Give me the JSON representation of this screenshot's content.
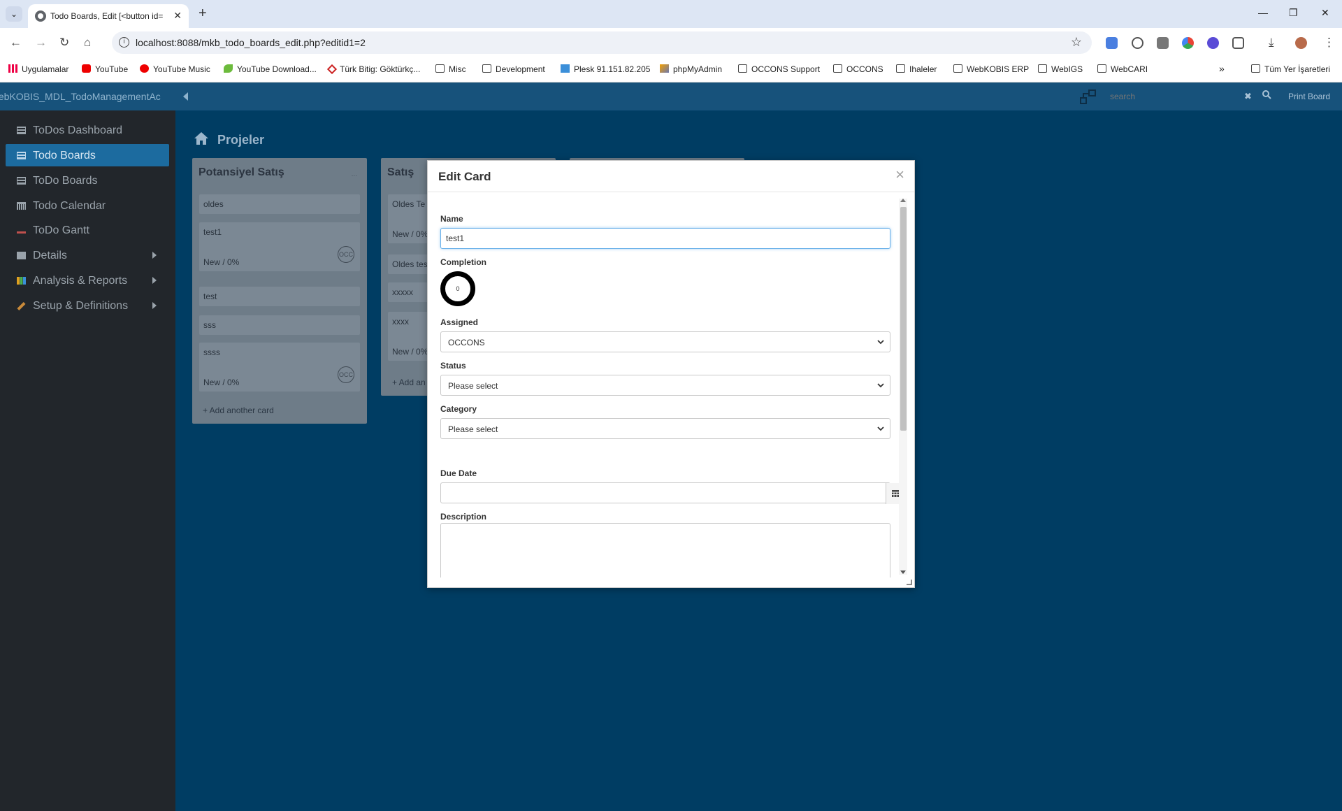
{
  "browser": {
    "tab_title": "Todo Boards, Edit [<button id=",
    "url": "localhost:8088/mkb_todo_boards_edit.php?editid1=2",
    "bookmarks": [
      {
        "label": "Uygulamalar",
        "icon": "apps-grid-icon"
      },
      {
        "label": "YouTube",
        "icon": "youtube-icon"
      },
      {
        "label": "YouTube Music",
        "icon": "youtube-music-icon"
      },
      {
        "label": "YouTube Download...",
        "icon": "leaf-icon"
      },
      {
        "label": "Türk Bitig: Göktürkç...",
        "icon": "gem-icon"
      },
      {
        "label": "Misc",
        "icon": "folder-icon"
      },
      {
        "label": "Development",
        "icon": "folder-icon"
      },
      {
        "label": "Plesk 91.151.82.205",
        "icon": "plesk-icon"
      },
      {
        "label": "phpMyAdmin",
        "icon": "phpmyadmin-icon"
      },
      {
        "label": "OCCONS Support",
        "icon": "folder-icon"
      },
      {
        "label": "OCCONS",
        "icon": "folder-icon"
      },
      {
        "label": "Ihaleler",
        "icon": "folder-icon"
      },
      {
        "label": "WebKOBIS ERP",
        "icon": "folder-icon"
      },
      {
        "label": "WebIGS",
        "icon": "folder-icon"
      },
      {
        "label": "WebCARI",
        "icon": "folder-icon"
      }
    ],
    "bookmarks_overflow": "»",
    "all_bookmarks": "Tüm Yer İşaretleri"
  },
  "app": {
    "name": "/ebKOBIS_MDL_TodoManagementAc",
    "search_placeholder": "search",
    "print_board": "Print Board"
  },
  "sidebar": {
    "items": [
      {
        "label": "ToDos Dashboard",
        "icon": "table-icon",
        "active": false,
        "has_submenu": false
      },
      {
        "label": "Todo Boards",
        "icon": "table-icon",
        "active": true,
        "has_submenu": false
      },
      {
        "label": "ToDo Boards",
        "icon": "table-icon",
        "active": false,
        "has_submenu": false
      },
      {
        "label": "Todo Calendar",
        "icon": "calendar-icon",
        "active": false,
        "has_submenu": false
      },
      {
        "label": "ToDo Gantt",
        "icon": "gantt-icon",
        "active": false,
        "has_submenu": false
      },
      {
        "label": "Details",
        "icon": "table-icon",
        "active": false,
        "has_submenu": true
      },
      {
        "label": "Analysis & Reports",
        "icon": "bar-chart-icon",
        "active": false,
        "has_submenu": true
      },
      {
        "label": "Setup & Definitions",
        "icon": "wrench-icon",
        "active": false,
        "has_submenu": true
      }
    ]
  },
  "page": {
    "title": "Projeler"
  },
  "board": {
    "columns": [
      {
        "title": "Potansiyel Satış",
        "menu": "...",
        "cards": [
          {
            "title": "oldes",
            "status": ""
          },
          {
            "title": "test1",
            "status": "New / 0%",
            "avatar": "OCC"
          },
          {
            "title": "test",
            "status": ""
          },
          {
            "title": "sss",
            "status": ""
          },
          {
            "title": "ssss",
            "status": "New / 0%",
            "avatar": "OCC"
          }
        ],
        "add_card": "+ Add another card"
      },
      {
        "title": "Satış",
        "cards": [
          {
            "title": "Oldes Te",
            "status": "New / 0%"
          },
          {
            "title": "Oldes tes",
            "status": ""
          },
          {
            "title": "xxxxx",
            "status": ""
          },
          {
            "title": "xxxx",
            "status": "New / 0%"
          }
        ],
        "add_card": "+ Add an"
      }
    ]
  },
  "modal": {
    "title": "Edit Card",
    "close": "×",
    "name_label": "Name",
    "name_value": "test1",
    "completion_label": "Completion",
    "completion_value": "0",
    "assigned_label": "Assigned",
    "assigned_value": "OCCONS",
    "status_label": "Status",
    "status_value": "Please select",
    "category_label": "Category",
    "category_value": "Please select",
    "due_date_label": "Due Date",
    "due_date_value": "",
    "description_label": "Description"
  }
}
